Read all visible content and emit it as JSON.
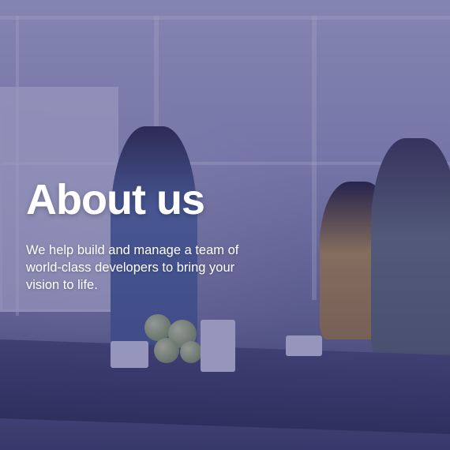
{
  "hero": {
    "title": "About us",
    "description": "We help build and manage a team of world-class developers to bring your vision to life."
  },
  "colors": {
    "overlay": "#302c78",
    "text": "#ffffff"
  }
}
